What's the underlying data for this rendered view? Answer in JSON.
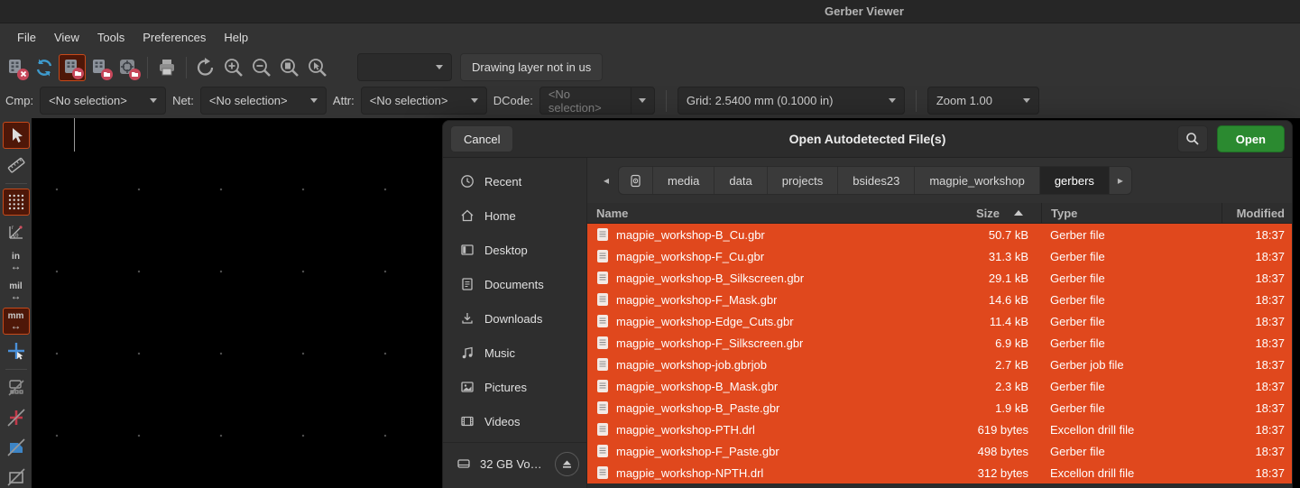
{
  "window": {
    "title": "Gerber Viewer"
  },
  "menubar": {
    "items": [
      "File",
      "View",
      "Tools",
      "Preferences",
      "Help"
    ]
  },
  "toolbar": {
    "layer_select_value": "",
    "layer_status": "Drawing layer not in us"
  },
  "filterbar": {
    "cmp_label": "Cmp:",
    "cmp_value": "<No selection>",
    "net_label": "Net:",
    "net_value": "<No selection>",
    "attr_label": "Attr:",
    "attr_value": "<No selection>",
    "dcode_label": "DCode:",
    "dcode_value": "<No selection>",
    "grid_value": "Grid: 2.5400 mm (0.1000 in)",
    "zoom_value": "Zoom 1.00"
  },
  "left_toolbar": {
    "unit_in": "in",
    "unit_mil": "mil",
    "unit_mm": "mm"
  },
  "dialog": {
    "title": "Open Autodetected File(s)",
    "cancel_label": "Cancel",
    "open_label": "Open",
    "sidebar": [
      {
        "label": "Recent",
        "icon": "clock"
      },
      {
        "label": "Home",
        "icon": "house"
      },
      {
        "label": "Desktop",
        "icon": "desktop"
      },
      {
        "label": "Documents",
        "icon": "document"
      },
      {
        "label": "Downloads",
        "icon": "download-arrow"
      },
      {
        "label": "Music",
        "icon": "music-note"
      },
      {
        "label": "Pictures",
        "icon": "picture"
      },
      {
        "label": "Videos",
        "icon": "film"
      }
    ],
    "volume": {
      "label": "32 GB Vo…"
    },
    "breadcrumbs": [
      "media",
      "data",
      "projects",
      "bsides23",
      "magpie_workshop",
      "gerbers"
    ],
    "columns": {
      "name": "Name",
      "size": "Size",
      "type": "Type",
      "modified": "Modified"
    },
    "files": [
      {
        "name": "magpie_workshop-B_Cu.gbr",
        "size": "50.7 kB",
        "type": "Gerber file",
        "modified": "18:37"
      },
      {
        "name": "magpie_workshop-F_Cu.gbr",
        "size": "31.3 kB",
        "type": "Gerber file",
        "modified": "18:37"
      },
      {
        "name": "magpie_workshop-B_Silkscreen.gbr",
        "size": "29.1 kB",
        "type": "Gerber file",
        "modified": "18:37"
      },
      {
        "name": "magpie_workshop-F_Mask.gbr",
        "size": "14.6 kB",
        "type": "Gerber file",
        "modified": "18:37"
      },
      {
        "name": "magpie_workshop-Edge_Cuts.gbr",
        "size": "11.4 kB",
        "type": "Gerber file",
        "modified": "18:37"
      },
      {
        "name": "magpie_workshop-F_Silkscreen.gbr",
        "size": "6.9 kB",
        "type": "Gerber file",
        "modified": "18:37"
      },
      {
        "name": "magpie_workshop-job.gbrjob",
        "size": "2.7 kB",
        "type": "Gerber job file",
        "modified": "18:37"
      },
      {
        "name": "magpie_workshop-B_Mask.gbr",
        "size": "2.3 kB",
        "type": "Gerber file",
        "modified": "18:37"
      },
      {
        "name": "magpie_workshop-B_Paste.gbr",
        "size": "1.9 kB",
        "type": "Gerber file",
        "modified": "18:37"
      },
      {
        "name": "magpie_workshop-PTH.drl",
        "size": "619 bytes",
        "type": "Excellon drill file",
        "modified": "18:37"
      },
      {
        "name": "magpie_workshop-F_Paste.gbr",
        "size": "498 bytes",
        "type": "Gerber file",
        "modified": "18:37"
      },
      {
        "name": "magpie_workshop-NPTH.drl",
        "size": "312 bytes",
        "type": "Excellon drill file",
        "modified": "18:37"
      }
    ]
  },
  "colors": {
    "selection": "#e0481d",
    "open_button": "#2b8a30",
    "active_tool_border": "#c64a1b",
    "refresh_blue": "#3e9bcd",
    "badge_red": "#c6475a",
    "canvas": "#000000"
  }
}
